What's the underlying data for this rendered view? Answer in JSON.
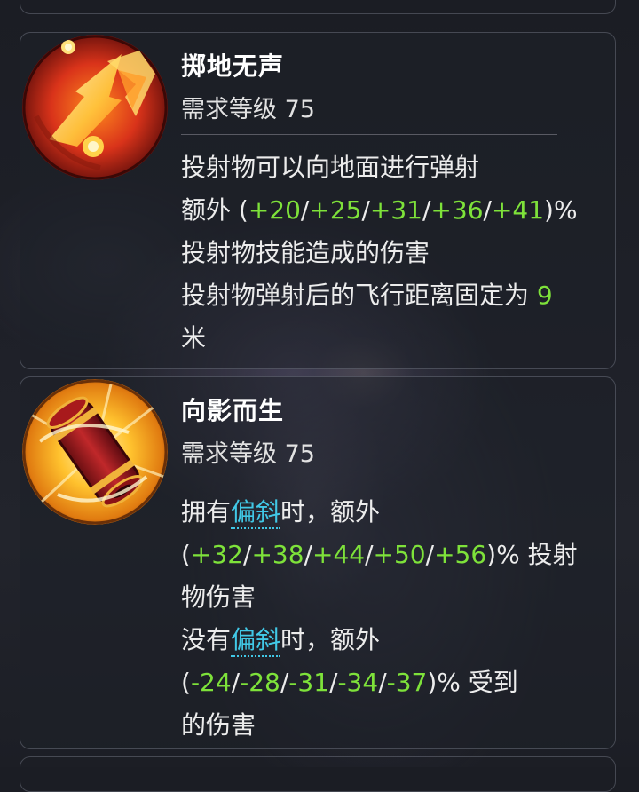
{
  "skills": [
    {
      "name": "掷地无声",
      "level": "需求等级 75",
      "icon": "fireball-bounce-icon",
      "desc": {
        "l1": "投射物可以向地面进行弹射",
        "l2_prefix": "额外 (",
        "l2_v1": "+20",
        "l2_s1": "/",
        "l2_v2": "+25",
        "l2_s2": "/",
        "l2_v3": "+31",
        "l2_s3": "/",
        "l2_v4": "+36",
        "l2_s4": "/",
        "l2_v5": "+41",
        "l2_suffix": ")%",
        "l3": "投射物技能造成的伤害",
        "l4_prefix": "投射物弹射后的飞行距离固定为 ",
        "l4_value": "9",
        "l5": "米"
      }
    },
    {
      "name": "向影而生",
      "level": "需求等级 75",
      "icon": "scroll-quiver-icon",
      "desc": {
        "l1_a": "拥有",
        "l1_kw": "偏斜",
        "l1_b": "时，额外",
        "l2_prefix": "(",
        "l2_v1": "+32",
        "l2_s1": "/",
        "l2_v2": "+38",
        "l2_s2": "/",
        "l2_v3": "+44",
        "l2_s3": "/",
        "l2_v4": "+50",
        "l2_s4": "/",
        "l2_v5": "+56",
        "l2_suffix": ")% 投射",
        "l3": "物伤害",
        "l4_a": "没有",
        "l4_kw": "偏斜",
        "l4_b": "时，额外",
        "l5_prefix": "(",
        "l5_v1": "-24",
        "l5_s1": "/",
        "l5_v2": "-28",
        "l5_s2": "/",
        "l5_v3": "-31",
        "l5_s3": "/",
        "l5_v4": "-34",
        "l5_s4": "/",
        "l5_v5": "-37",
        "l5_suffix": ")% 受到",
        "l6": "的伤害"
      }
    }
  ],
  "colors": {
    "value_green": "#7ee23a",
    "keyword_cyan": "#41c8e6",
    "card_border": "#9a9baa"
  }
}
